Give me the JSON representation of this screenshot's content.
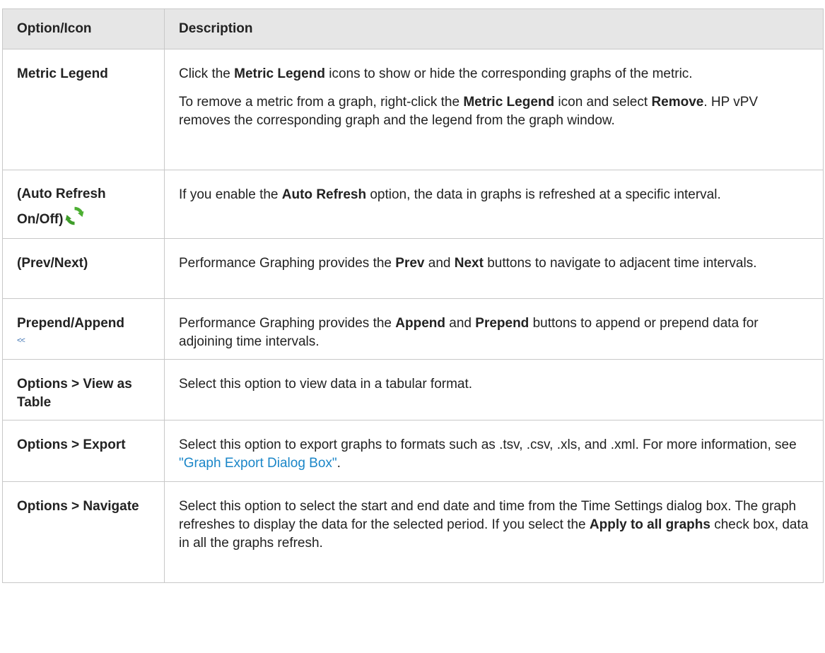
{
  "header": {
    "col1": "Option/Icon",
    "col2": "Description"
  },
  "rows": [
    {
      "option": "Metric Legend",
      "p1_a": "Click the ",
      "p1_b": "Metric Legend",
      "p1_c": " icons to show or hide the corresponding graphs of the metric.",
      "p2_a": "To remove a metric from a graph, right-click the ",
      "p2_b": "Metric Legend",
      "p2_c": " icon and select ",
      "p2_d": "Remove",
      "p2_e": ". HP vPV removes the corresponding graph and the legend from the graph window."
    },
    {
      "option": "(Auto Refresh On/Off)",
      "icon": "refresh-icon",
      "p1_a": "If you enable the ",
      "p1_b": "Auto Refresh",
      "p1_c": " option, the data in graphs is refreshed at a specific interval."
    },
    {
      "option": "(Prev/Next)",
      "p1_a": "Performance Graphing provides the ",
      "p1_b": "Prev",
      "p1_c": " and ",
      "p1_d": "Next",
      "p1_e": " buttons to navigate to adjacent time intervals."
    },
    {
      "option": "Prepend/Append",
      "icon_text": "<<",
      "p1_a": "Performance Graphing provides the ",
      "p1_b": "Append",
      "p1_c": " and ",
      "p1_d": "Prepend",
      "p1_e": " buttons to append or prepend data for adjoining time intervals."
    },
    {
      "option": "Options > View as Table",
      "p1_a": "Select this option to view data in a tabular format."
    },
    {
      "option": "Options > Export",
      "p1_a": "Select this option to export graphs to formats such as .tsv, .csv, .xls, and .xml. For more information, see ",
      "link": "\"Graph Export Dialog Box\"",
      "p1_c": "."
    },
    {
      "option": "Options > Navigate",
      "p1_a": "Select this option to select the start and end date and time from the Time Settings dialog box. The graph refreshes to display the data for the selected period. If you select the ",
      "p1_b": "Apply to all graphs",
      "p1_c": " check box, data in all the graphs refresh."
    }
  ],
  "colors": {
    "header_bg": "#e6e6e6",
    "border": "#c8c8c8",
    "link": "#1a86c8",
    "icon_green": "#4caf32"
  }
}
